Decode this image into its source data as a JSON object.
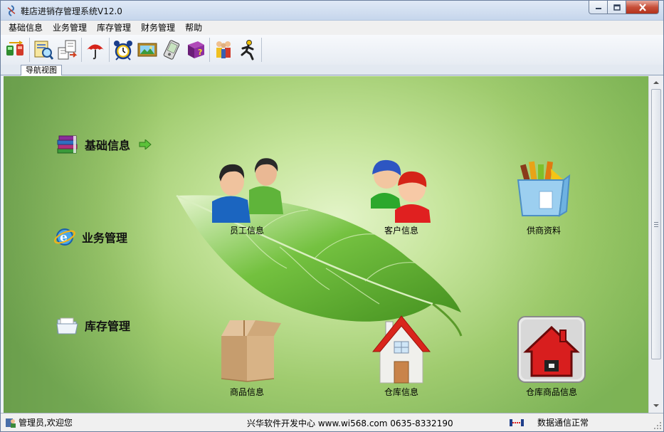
{
  "window": {
    "title": "鞋店进销存管理系统V12.0"
  },
  "menu": [
    "基础信息",
    "业务管理",
    "库存管理",
    "财务管理",
    "帮助"
  ],
  "toolbar": [
    {
      "icon": "traffic-exchange-icon"
    },
    {
      "icon": "document-search-icon"
    },
    {
      "icon": "document-transfer-icon"
    },
    {
      "icon": "umbrella-icon"
    },
    {
      "icon": "alarm-clock-icon"
    },
    {
      "icon": "picture-frame-icon"
    },
    {
      "icon": "pda-icon"
    },
    {
      "icon": "help-book-icon"
    },
    {
      "icon": "users-group-icon"
    },
    {
      "icon": "running-man-exit-icon"
    }
  ],
  "tabs": {
    "nav": "导航视图"
  },
  "nav_left": [
    "基础信息",
    "业务管理",
    "库存管理"
  ],
  "tiles": {
    "employee": "员工信息",
    "customer": "客户信息",
    "supplier": "供商资料",
    "product": "商品信息",
    "warehouse": "仓库信息",
    "warehouse_product": "仓库商品信息"
  },
  "status": {
    "user": "管理员,欢迎您",
    "vendor": "兴华软件开发中心 www.wi568.com 0635-8332190",
    "connection": "数据通信正常"
  },
  "colors": {
    "accent_green": "#7eb35a",
    "house_red": "#d9251c"
  }
}
